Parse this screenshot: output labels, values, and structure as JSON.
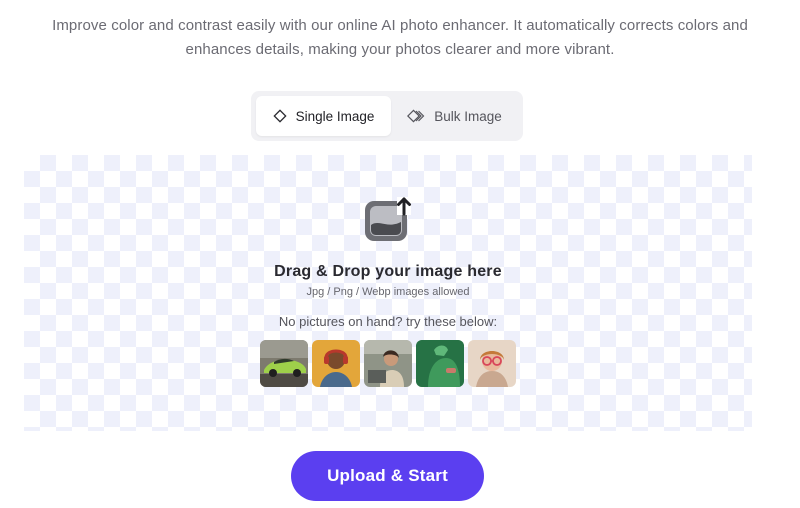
{
  "intro": {
    "line1": "Improve color and contrast easily with our online AI photo enhancer. It automatically corrects colors and",
    "line2": "enhances details, making your photos clearer and more vibrant."
  },
  "mode_tabs": [
    {
      "label": "Single Image",
      "icon": "diamond-icon",
      "active": true
    },
    {
      "label": "Bulk Image",
      "icon": "layered-diamonds-icon",
      "active": false
    }
  ],
  "dropzone": {
    "icon": "image-upload-icon",
    "title": "Drag & Drop your image here",
    "formats": "Jpg / Png / Webp images allowed",
    "hint": "No pictures on hand? try these below:",
    "samples": [
      {
        "name": "sample-car",
        "icon": "car-photo"
      },
      {
        "name": "sample-man-orange",
        "icon": "portrait-photo"
      },
      {
        "name": "sample-woman-laptop",
        "icon": "portrait-photo"
      },
      {
        "name": "sample-green-dress",
        "icon": "portrait-photo"
      },
      {
        "name": "sample-woman-glasses",
        "icon": "portrait-photo"
      }
    ]
  },
  "upload_button": {
    "label": "Upload & Start"
  },
  "colors": {
    "accent": "#5b3ff0",
    "checker": "#eef0fb",
    "text_muted": "#6b6b73"
  }
}
